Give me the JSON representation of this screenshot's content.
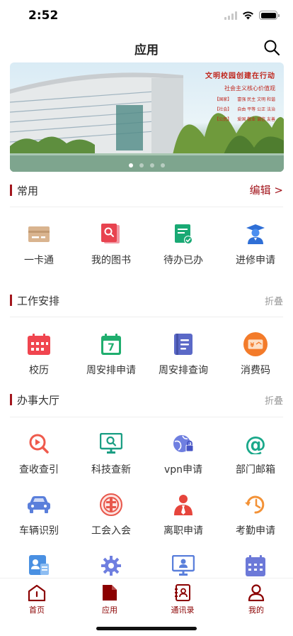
{
  "status_bar": {
    "time": "2:52"
  },
  "header": {
    "title": "应用"
  },
  "banner": {
    "slogan_title": "文明校园创建在行动",
    "slogan_subtitle": "社会主义核心价值观",
    "lines": [
      {
        "tag": "【国家】",
        "text": "富强 民主 文明 和谐"
      },
      {
        "tag": "【社会】",
        "text": "自由 平等 公正 法治"
      },
      {
        "tag": "【公民】",
        "text": "爱国 敬业 诚信 友善"
      }
    ]
  },
  "sections": {
    "common": {
      "title": "常用",
      "action": "编辑 >",
      "items": [
        {
          "label": "一卡通",
          "icon": "card-icon"
        },
        {
          "label": "我的图书",
          "icon": "book-search-icon"
        },
        {
          "label": "待办已办",
          "icon": "todo-check-icon"
        },
        {
          "label": "进修申请",
          "icon": "graduate-icon"
        }
      ]
    },
    "work": {
      "title": "工作安排",
      "action": "折叠",
      "items": [
        {
          "label": "校历",
          "icon": "calendar-icon"
        },
        {
          "label": "周安排申请",
          "icon": "calendar-7-icon"
        },
        {
          "label": "周安排查询",
          "icon": "notebook-icon"
        },
        {
          "label": "消费码",
          "icon": "consume-code-icon"
        }
      ]
    },
    "office": {
      "title": "办事大厅",
      "action": "折叠",
      "items": [
        {
          "label": "查收查引",
          "icon": "search-play-icon"
        },
        {
          "label": "科技查新",
          "icon": "monitor-search-icon"
        },
        {
          "label": "vpn申请",
          "icon": "globe-lock-icon"
        },
        {
          "label": "部门邮箱",
          "icon": "at-icon"
        },
        {
          "label": "车辆识别",
          "icon": "car-icon"
        },
        {
          "label": "工会入会",
          "icon": "union-badge-icon"
        },
        {
          "label": "离职申请",
          "icon": "person-tie-icon"
        },
        {
          "label": "考勤申请",
          "icon": "clock-icon"
        },
        {
          "label": "",
          "icon": "profile-card-icon"
        },
        {
          "label": "",
          "icon": "settings-gear-icon"
        },
        {
          "label": "",
          "icon": "monitor-person-icon"
        },
        {
          "label": "",
          "icon": "calendar-grid-icon"
        }
      ]
    }
  },
  "tabs": [
    {
      "label": "首页",
      "icon": "home-icon"
    },
    {
      "label": "应用",
      "icon": "document-icon"
    },
    {
      "label": "通讯录",
      "icon": "contacts-icon"
    },
    {
      "label": "我的",
      "icon": "user-icon"
    }
  ],
  "colors": {
    "accent": "#a3161d",
    "tab_text": "#8b0000",
    "muted": "#999999"
  }
}
